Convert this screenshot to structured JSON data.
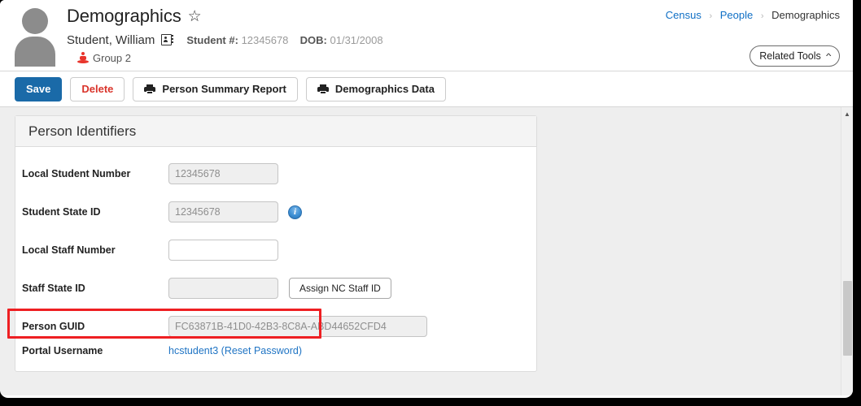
{
  "header": {
    "page_title": "Demographics",
    "favorite_icon": "star-outline-icon",
    "person_name": "Student, William",
    "contact_card_icon": "contact-card-icon",
    "student_number_label": "Student #:",
    "student_number_value": "12345678",
    "dob_label": "DOB:",
    "dob_value": "01/31/2008",
    "group_icon": "person-marker-icon",
    "group_label": "Group 2"
  },
  "breadcrumb": {
    "items": [
      {
        "label": "Census",
        "link": true
      },
      {
        "label": "People",
        "link": true
      },
      {
        "label": "Demographics",
        "link": false
      }
    ],
    "separator": "›"
  },
  "related_tools": {
    "label": "Related Tools",
    "chevron_icon": "chevron-up-icon"
  },
  "toolbar": {
    "save_label": "Save",
    "delete_label": "Delete",
    "person_summary_report_label": "Person Summary Report",
    "demographics_data_label": "Demographics Data",
    "print_icon": "printer-icon"
  },
  "card": {
    "title": "Person Identifiers",
    "fields": [
      {
        "label": "Local Student Number",
        "value": "12345678",
        "readonly": true
      },
      {
        "label": "Student State ID",
        "value": "12345678",
        "readonly": true,
        "info_icon": "info-circle-icon",
        "highlighted": true
      },
      {
        "label": "Local Staff Number",
        "value": "",
        "readonly": false
      },
      {
        "label": "Staff State ID",
        "value": "",
        "readonly": true,
        "button_label": "Assign NC Staff ID"
      },
      {
        "label": "Person GUID",
        "value": "FC63871B-41D0-42B3-8C8A-ABD44652CFD4",
        "readonly": true
      }
    ],
    "portal": {
      "label": "Portal Username",
      "username": "hcstudent3",
      "reset_password_label": "(Reset Password)"
    }
  },
  "scrollbar": {
    "up_arrow_icon": "chevron-up-icon"
  },
  "colors": {
    "accent_blue": "#1a6aa8",
    "link_blue": "#0f6fc5",
    "delete_red": "#d9342b",
    "highlight_red": "#ee1f22",
    "group_red": "#e8352c"
  }
}
